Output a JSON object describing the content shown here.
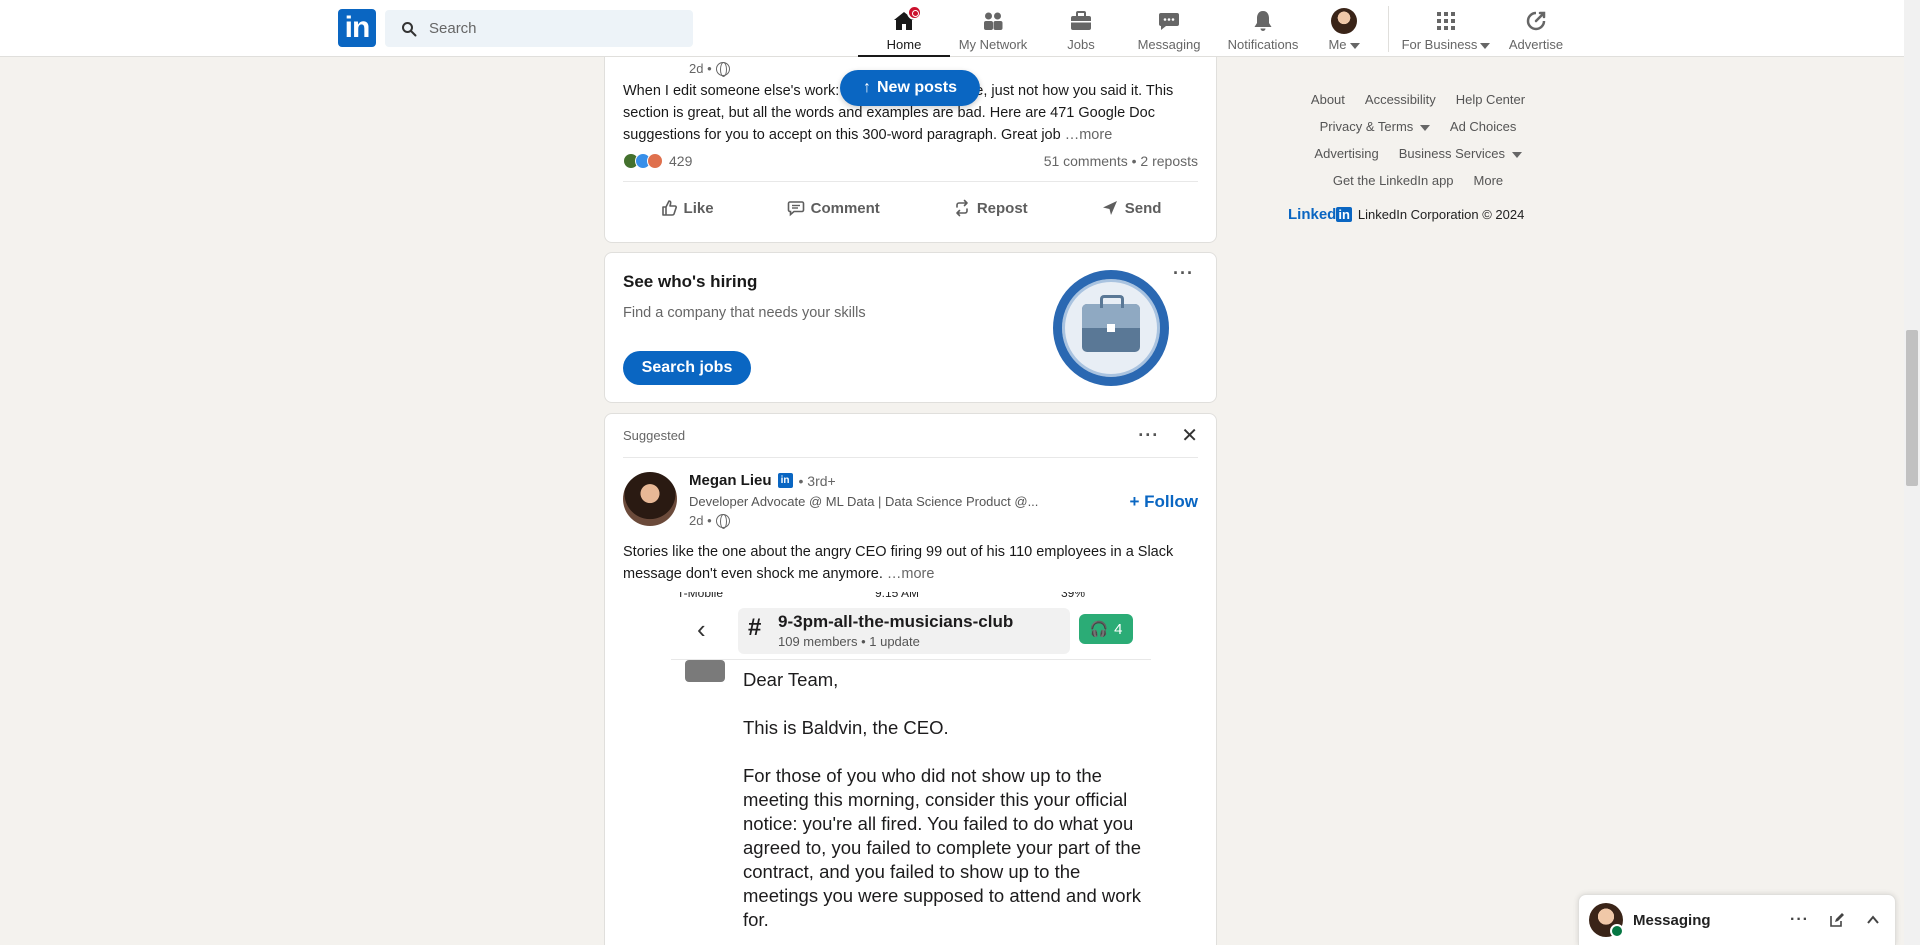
{
  "nav": {
    "search_placeholder": "Search",
    "items": [
      {
        "label": "Home"
      },
      {
        "label": "My Network"
      },
      {
        "label": "Jobs"
      },
      {
        "label": "Messaging"
      },
      {
        "label": "Notifications"
      },
      {
        "label": "Me"
      },
      {
        "label": "For Business"
      },
      {
        "label": "Advertise"
      }
    ]
  },
  "new_posts_label": "New posts",
  "post_top": {
    "time": "2d •",
    "text": "When I edit someone else's work: The idea is good here, just not how you said it. This section is great, but all the words and examples are bad. Here are 471 Google Doc suggestions for you to accept on this 300-word paragraph. Great job",
    "more": "…more",
    "reaction_count": "429",
    "comments_reposts": "51 comments • 2 reposts",
    "actions": [
      "Like",
      "Comment",
      "Repost",
      "Send"
    ]
  },
  "hiring": {
    "title": "See who's hiring",
    "subtitle": "Find a company that needs your skills",
    "button": "Search jobs",
    "menu": "···"
  },
  "suggested": {
    "label": "Suggested",
    "menu": "···",
    "author": "Megan Lieu",
    "degree": "• 3rd+",
    "headline": "Developer Advocate @ ML Data | Data Science Product @...",
    "time": "2d •",
    "follow": "+ Follow",
    "text": "Stories like the one about the angry CEO firing 99 out of his 110 employees in a Slack message don't even shock me anymore.",
    "more": "…more",
    "image": {
      "status_left": "T-Mobile",
      "status_time": "9:15 AM",
      "status_right": "39%",
      "channel": "9-3pm-all-the-musicians-club",
      "channel_meta": "109 members • 1 update",
      "huddle_count": "4",
      "lines": [
        "Dear Team,",
        "This is Baldvin, the CEO.",
        "For those of you who did not show up to the meeting this morning, consider this your official notice: you're all fired. You failed to do what you agreed to, you failed to complete your part of the contract, and you failed to show up to the meetings you were supposed to attend and work for."
      ]
    }
  },
  "footer": {
    "row1": [
      "About",
      "Accessibility",
      "Help Center"
    ],
    "row2": [
      "Privacy & Terms",
      "Ad Choices"
    ],
    "row3": [
      "Advertising",
      "Business Services"
    ],
    "row4": [
      "Get the LinkedIn app",
      "More"
    ],
    "brand": "Linked",
    "brand_box": "in",
    "copyright": "LinkedIn Corporation © 2024"
  },
  "messaging_dock": {
    "title": "Messaging"
  },
  "colors": {
    "brand": "#0a66c2",
    "background": "#f4f2ee",
    "notification": "#cb112d"
  }
}
